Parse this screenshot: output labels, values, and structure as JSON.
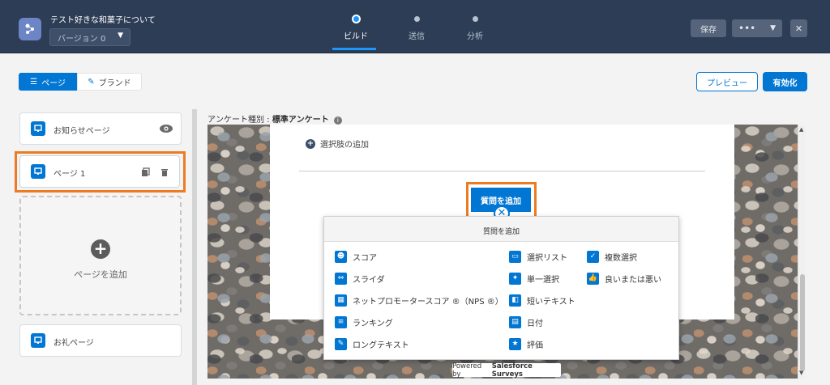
{
  "header": {
    "survey_title": "テスト好きな和菓子について",
    "version_label": "バージョン 0",
    "tabs": [
      {
        "label": "ビルド",
        "active": true
      },
      {
        "label": "送信",
        "active": false
      },
      {
        "label": "分析",
        "active": false
      }
    ],
    "save_label": "保存",
    "more_label": "•••",
    "close_label": "✕"
  },
  "toolbar": {
    "page_toggle": "ページ",
    "brand_toggle": "ブランド",
    "preview_label": "プレビュー",
    "activate_label": "有効化"
  },
  "sidebar": {
    "pages": [
      {
        "label": "お知らせページ"
      },
      {
        "label": "ページ 1"
      }
    ],
    "add_page_label": "ページを追加",
    "thanks_page_label": "お礼ページ"
  },
  "canvas": {
    "survey_type_prefix": "アンケート種別 : ",
    "survey_type_value": "標準アンケート",
    "add_option_label": "選択肢の追加",
    "add_question_button": "質問を追加",
    "powered_prefix": "Powered by ",
    "powered_brand": "Salesforce Surveys"
  },
  "question_menu": {
    "header": "質問を追加",
    "col1": [
      {
        "label": "スコア",
        "icon": "smiley-icon"
      },
      {
        "label": "スライダ",
        "icon": "slider-icon"
      },
      {
        "label": "ネットプロモータースコア ®（NPS ®）",
        "icon": "nps-icon"
      },
      {
        "label": "ランキング",
        "icon": "ranking-icon"
      },
      {
        "label": "ロングテキスト",
        "icon": "long-text-icon"
      }
    ],
    "col2": [
      {
        "label": "選択リスト",
        "icon": "picklist-icon"
      },
      {
        "label": "単一選択",
        "icon": "single-select-icon"
      },
      {
        "label": "短いテキスト",
        "icon": "short-text-icon"
      },
      {
        "label": "日付",
        "icon": "calendar-icon"
      },
      {
        "label": "評価",
        "icon": "star-icon"
      }
    ],
    "col3": [
      {
        "label": "複数選択",
        "icon": "checkbox-icon"
      },
      {
        "label": "良いまたは悪い",
        "icon": "thumbs-up-icon"
      }
    ]
  },
  "colors": {
    "brand": "#0176d3",
    "header": "#2d3d55",
    "highlight": "#ee7b21"
  }
}
